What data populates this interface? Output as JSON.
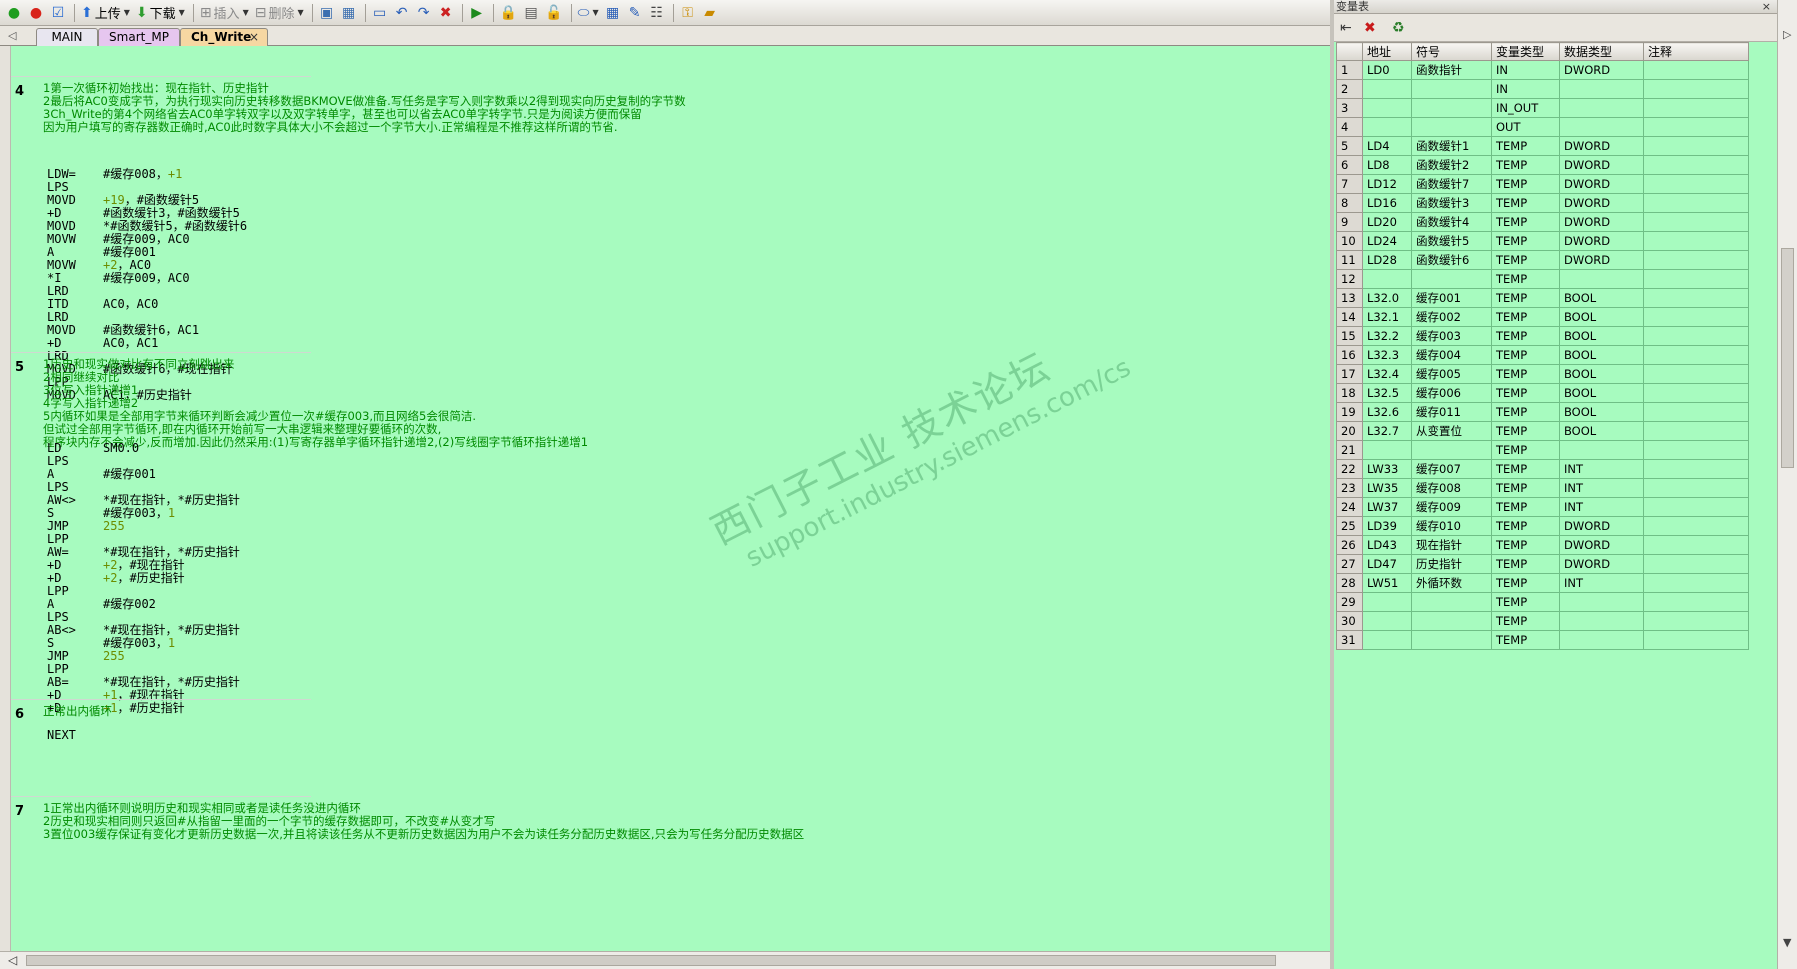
{
  "toolbar": {
    "upload_label": "上传",
    "download_label": "下载",
    "insert_label": "插入",
    "delete_label": "删除"
  },
  "tabs": [
    {
      "label": "MAIN"
    },
    {
      "label": "Smart_MP"
    },
    {
      "label": "Ch_Write",
      "close": "×"
    }
  ],
  "networks": [
    {
      "number": "4",
      "comment": "1第一次循环初始找出：现在指针、历史指针\n2最后将AC0变成字节，为执行现实向历史转移数据BKMOVE做准备.写任务是字写入则字数乘以2得到现实向历史复制的字节数\n3Ch_Write的第4个网络省去AC0单字转双字以及双字转单字，甚至也可以省去AC0单字转字节.只是为阅读方便而保留\n因为用户填写的寄存器数正确时,AC0此时数字具体大小不会超过一个字节大小.正常编程是不推荐这样所谓的节省.",
      "lines": [
        {
          "op": "LDW=",
          "a": "#缓存008，",
          "lit": "+1"
        },
        {
          "op": "LPS",
          "a": "",
          "lit": ""
        },
        {
          "op": "MOVD",
          "a": "",
          "lit": "+19",
          "b": "，#函数缓针5"
        },
        {
          "op": "+D",
          "a": "#函数缓针3，#函数缓针5",
          "lit": ""
        },
        {
          "op": "MOVD",
          "a": "*#函数缓针5，#函数缓针6",
          "lit": ""
        },
        {
          "op": "MOVW",
          "a": "#缓存009，AC0",
          "lit": ""
        },
        {
          "op": "A",
          "a": "#缓存001",
          "lit": ""
        },
        {
          "op": "MOVW",
          "a": "",
          "lit": "+2",
          "b": "，AC0"
        },
        {
          "op": "*I",
          "a": "#缓存009，AC0",
          "lit": ""
        },
        {
          "op": "LRD",
          "a": "",
          "lit": ""
        },
        {
          "op": "ITD",
          "a": "AC0，AC0",
          "lit": ""
        },
        {
          "op": "LRD",
          "a": "",
          "lit": ""
        },
        {
          "op": "MOVD",
          "a": "#函数缓针6，AC1",
          "lit": ""
        },
        {
          "op": "+D",
          "a": "AC0，AC1",
          "lit": ""
        },
        {
          "op": "LRD",
          "a": "",
          "lit": ""
        },
        {
          "op": "MOVD",
          "a": "#函数缓针6，#现在指针",
          "lit": ""
        },
        {
          "op": "LPP",
          "a": "",
          "lit": ""
        },
        {
          "op": "MOVD",
          "a": "AC1，#历史指针",
          "lit": ""
        }
      ]
    },
    {
      "number": "5",
      "comment": "1历史和现实做对比有不同立刻跳出来\n2相同继续对比\n3位写入指针递增1\n4字写入指针递增2\n5内循环如果是全部用字节来循环判断会减少置位一次#缓存003,而且网络5会很简洁.\n但试过全部用字节循环,即在内循环开始前写一大串逻辑来整理好要循环的次数,\n程序块内存不会减少,反而增加.因此仍然采用:(1)写寄存器单字循环指针递增2,(2)写线圈字节循环指针递增1",
      "lines": [
        {
          "op": "LD",
          "a": "SM0.0",
          "lit": ""
        },
        {
          "op": "LPS",
          "a": "",
          "lit": ""
        },
        {
          "op": "A",
          "a": "#缓存001",
          "lit": ""
        },
        {
          "op": "LPS",
          "a": "",
          "lit": ""
        },
        {
          "op": "AW<>",
          "a": "*#现在指针，*#历史指针",
          "lit": ""
        },
        {
          "op": "S",
          "a": "#缓存003，",
          "lit": "1"
        },
        {
          "op": "JMP",
          "a": "",
          "lit": "255"
        },
        {
          "op": "LPP",
          "a": "",
          "lit": ""
        },
        {
          "op": "AW=",
          "a": "*#现在指针，*#历史指针",
          "lit": ""
        },
        {
          "op": "+D",
          "a": "",
          "lit": "+2",
          "b": "，#现在指针"
        },
        {
          "op": "+D",
          "a": "",
          "lit": "+2",
          "b": "，#历史指针"
        },
        {
          "op": "LPP",
          "a": "",
          "lit": ""
        },
        {
          "op": "A",
          "a": "#缓存002",
          "lit": ""
        },
        {
          "op": "LPS",
          "a": "",
          "lit": ""
        },
        {
          "op": "AB<>",
          "a": "*#现在指针，*#历史指针",
          "lit": ""
        },
        {
          "op": "S",
          "a": "#缓存003，",
          "lit": "1"
        },
        {
          "op": "JMP",
          "a": "",
          "lit": "255"
        },
        {
          "op": "LPP",
          "a": "",
          "lit": ""
        },
        {
          "op": "AB=",
          "a": "*#现在指针，*#历史指针",
          "lit": ""
        },
        {
          "op": "+D",
          "a": "",
          "lit": "+1",
          "b": "，#现在指针"
        },
        {
          "op": "+D",
          "a": "",
          "lit": "+1",
          "b": "，#历史指针"
        }
      ]
    },
    {
      "number": "6",
      "comment": "正常出内循环",
      "lines": [
        {
          "op": "NEXT",
          "a": "",
          "lit": ""
        }
      ]
    },
    {
      "number": "7",
      "comment": "1正常出内循环则说明历史和现实相同或者是读任务没进内循环\n2历史和现实相同则只返回#从指留一里面的一个字节的缓存数据即可，不改变#从变才写\n3置位003缓存保证有变化才更新历史数据一次,并且将读该任务从不更新历史数据因为用户不会为读任务分配历史数据区,只会为写任务分配历史数据区",
      "lines": []
    }
  ],
  "var_panel": {
    "title": "变量表",
    "close": "×",
    "headers": [
      "",
      "地址",
      "符号",
      "变量类型",
      "数据类型",
      "注释"
    ],
    "rows": [
      [
        "1",
        "LD0",
        "函数指针",
        "IN",
        "DWORD",
        ""
      ],
      [
        "2",
        "",
        "",
        "IN",
        "",
        ""
      ],
      [
        "3",
        "",
        "",
        "IN_OUT",
        "",
        ""
      ],
      [
        "4",
        "",
        "",
        "OUT",
        "",
        ""
      ],
      [
        "5",
        "LD4",
        "函数缓针1",
        "TEMP",
        "DWORD",
        ""
      ],
      [
        "6",
        "LD8",
        "函数缓针2",
        "TEMP",
        "DWORD",
        ""
      ],
      [
        "7",
        "LD12",
        "函数缓针7",
        "TEMP",
        "DWORD",
        ""
      ],
      [
        "8",
        "LD16",
        "函数缓针3",
        "TEMP",
        "DWORD",
        ""
      ],
      [
        "9",
        "LD20",
        "函数缓针4",
        "TEMP",
        "DWORD",
        ""
      ],
      [
        "10",
        "LD24",
        "函数缓针5",
        "TEMP",
        "DWORD",
        ""
      ],
      [
        "11",
        "LD28",
        "函数缓针6",
        "TEMP",
        "DWORD",
        ""
      ],
      [
        "12",
        "",
        "",
        "TEMP",
        "",
        ""
      ],
      [
        "13",
        "L32.0",
        "缓存001",
        "TEMP",
        "BOOL",
        ""
      ],
      [
        "14",
        "L32.1",
        "缓存002",
        "TEMP",
        "BOOL",
        ""
      ],
      [
        "15",
        "L32.2",
        "缓存003",
        "TEMP",
        "BOOL",
        ""
      ],
      [
        "16",
        "L32.3",
        "缓存004",
        "TEMP",
        "BOOL",
        ""
      ],
      [
        "17",
        "L32.4",
        "缓存005",
        "TEMP",
        "BOOL",
        ""
      ],
      [
        "18",
        "L32.5",
        "缓存006",
        "TEMP",
        "BOOL",
        ""
      ],
      [
        "19",
        "L32.6",
        "缓存011",
        "TEMP",
        "BOOL",
        ""
      ],
      [
        "20",
        "L32.7",
        "从变置位",
        "TEMP",
        "BOOL",
        ""
      ],
      [
        "21",
        "",
        "",
        "TEMP",
        "",
        ""
      ],
      [
        "22",
        "LW33",
        "缓存007",
        "TEMP",
        "INT",
        ""
      ],
      [
        "23",
        "LW35",
        "缓存008",
        "TEMP",
        "INT",
        ""
      ],
      [
        "24",
        "LW37",
        "缓存009",
        "TEMP",
        "INT",
        ""
      ],
      [
        "25",
        "LD39",
        "缓存010",
        "TEMP",
        "DWORD",
        ""
      ],
      [
        "26",
        "LD43",
        "现在指针",
        "TEMP",
        "DWORD",
        ""
      ],
      [
        "27",
        "LD47",
        "历史指针",
        "TEMP",
        "DWORD",
        ""
      ],
      [
        "28",
        "LW51",
        "外循环数",
        "TEMP",
        "INT",
        ""
      ],
      [
        "29",
        "",
        "",
        "TEMP",
        "",
        ""
      ],
      [
        "30",
        "",
        "",
        "TEMP",
        "",
        ""
      ],
      [
        "31",
        "",
        "",
        "TEMP",
        "",
        ""
      ]
    ]
  },
  "watermark": {
    "line1": "西门子工业 技术论坛",
    "line2": "support.industry.siemens.com/cs"
  },
  "colors": {
    "editor_bg": "#a7fbbf",
    "comment": "#008a00",
    "literal": "#6c8d00"
  }
}
